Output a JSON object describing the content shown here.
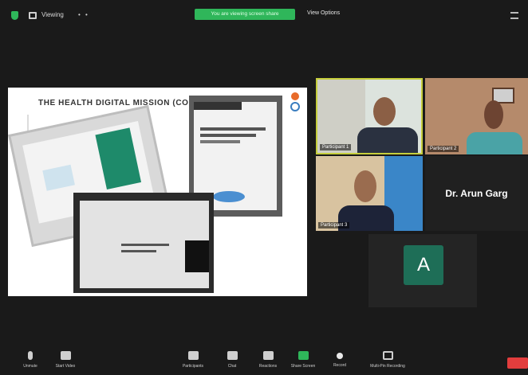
{
  "top_bar": {
    "view_label": "Viewing",
    "share_banner": "You are viewing screen share",
    "view_options": "View Options"
  },
  "shared_screen": {
    "slide_title": "THE HEALTH DIGITAL MISSION (CONT'D)"
  },
  "participants": [
    {
      "name": "Participant 1",
      "video": true
    },
    {
      "name": "Participant 2",
      "video": true
    },
    {
      "name": "Participant 3",
      "video": true
    },
    {
      "name": "Dr. Arun Garg",
      "video": false
    },
    {
      "name": "A",
      "video": false,
      "avatar_letter": "A",
      "avatar_color": "#1e6e57"
    }
  ],
  "toolbar": {
    "unmute": "Unmute",
    "start_video": "Start Video",
    "participants": "Participants",
    "chat": "Chat",
    "reactions": "Reactions",
    "share_screen": "Share Screen",
    "record": "Record",
    "more": "Multi-Pin Recording"
  },
  "colors": {
    "accent_green": "#2fb65a",
    "end_red": "#e23d3d",
    "active_speaker_border": "#c6ce3c"
  }
}
